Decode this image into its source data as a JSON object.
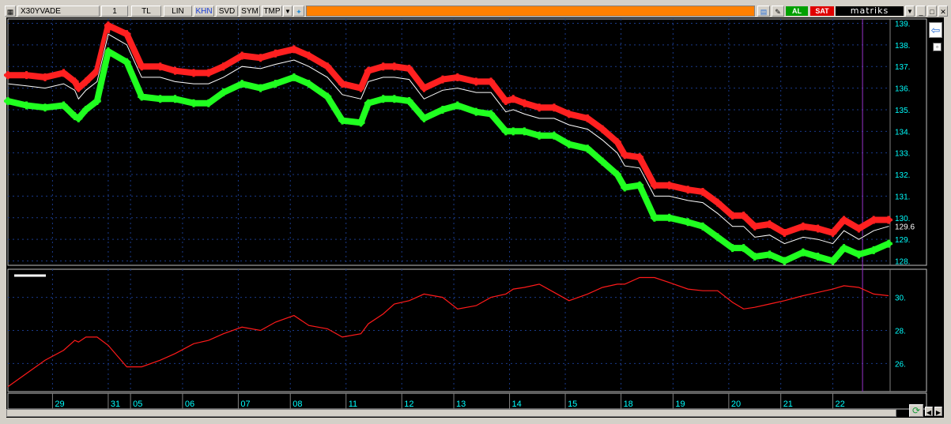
{
  "toolbar": {
    "symbol": "X30YVADE",
    "period": "1",
    "currency": "TL",
    "scale": "LIN",
    "khn": "KHN",
    "svd": "SVD",
    "sym": "SYM",
    "tmp": "TMP",
    "buy_label": "AL",
    "sell_label": "SAT",
    "brand": "matriks"
  },
  "colors": {
    "upper_band": "#ff2020",
    "lower_band": "#20ff20",
    "price": "#ffffff",
    "indicator": "#ff1a1a",
    "axis_text": "#00ffff",
    "grid": "#1a3a8a",
    "orange_bar": "#ff8000"
  },
  "chart_data": [
    {
      "type": "line",
      "panel": "price",
      "ylim": [
        127.8,
        139.2
      ],
      "yticks": [
        "128.",
        "129.",
        "130.",
        "131.",
        "132.",
        "133.",
        "134.",
        "135.",
        "136.",
        "137.",
        "138.",
        "139."
      ],
      "last_value_label": "129.6",
      "x_index": [
        0,
        5,
        10,
        15,
        18,
        19,
        21,
        24,
        27,
        32,
        36,
        41,
        45,
        50,
        54,
        58,
        63,
        68,
        72,
        77,
        81,
        86,
        90,
        95,
        97,
        101,
        104,
        108,
        112,
        117,
        121,
        126,
        130,
        134,
        136,
        139,
        143,
        147,
        151,
        156,
        160,
        164,
        166,
        170,
        174,
        178,
        183,
        187,
        191,
        195,
        198,
        201,
        205,
        209,
        214,
        218,
        222,
        225,
        229,
        233,
        237
      ],
      "series": [
        {
          "role": "upper",
          "values": [
            136.6,
            136.6,
            136.5,
            136.7,
            136.3,
            136.0,
            136.3,
            136.8,
            138.9,
            138.5,
            137.0,
            137.0,
            136.8,
            136.7,
            136.7,
            137.0,
            137.5,
            137.4,
            137.6,
            137.8,
            137.5,
            137.0,
            136.2,
            136.0,
            136.8,
            137.0,
            137.0,
            136.9,
            136.0,
            136.4,
            136.5,
            136.3,
            136.3,
            135.4,
            135.5,
            135.3,
            135.1,
            135.1,
            134.8,
            134.6,
            134.1,
            133.5,
            132.9,
            132.8,
            131.5,
            131.5,
            131.3,
            131.2,
            130.7,
            130.1,
            130.1,
            129.6,
            129.7,
            129.3,
            129.6,
            129.5,
            129.3,
            129.9,
            129.5,
            129.9,
            129.9
          ]
        },
        {
          "role": "price",
          "values": [
            136.2,
            136.1,
            136.0,
            136.2,
            135.9,
            135.5,
            135.9,
            136.3,
            138.5,
            138.0,
            136.5,
            136.5,
            136.3,
            136.2,
            136.2,
            136.5,
            137.0,
            136.9,
            137.1,
            137.3,
            137.0,
            136.5,
            135.7,
            135.5,
            136.3,
            136.5,
            136.5,
            136.4,
            135.5,
            135.9,
            136.0,
            135.8,
            135.8,
            134.9,
            135.0,
            134.8,
            134.6,
            134.6,
            134.3,
            134.1,
            133.6,
            133.0,
            132.4,
            132.3,
            131.0,
            131.0,
            130.8,
            130.7,
            130.2,
            129.6,
            129.6,
            129.1,
            129.2,
            128.8,
            129.1,
            129.0,
            128.8,
            129.4,
            129.0,
            129.4,
            129.6
          ]
        },
        {
          "role": "lower",
          "values": [
            135.4,
            135.2,
            135.1,
            135.2,
            134.7,
            134.6,
            135.0,
            135.4,
            137.7,
            137.2,
            135.6,
            135.5,
            135.5,
            135.3,
            135.3,
            135.8,
            136.2,
            136.0,
            136.2,
            136.5,
            136.2,
            135.6,
            134.5,
            134.4,
            135.3,
            135.5,
            135.5,
            135.4,
            134.6,
            135.0,
            135.2,
            134.9,
            134.8,
            134.0,
            134.0,
            134.0,
            133.8,
            133.8,
            133.4,
            133.2,
            132.6,
            132.0,
            131.4,
            131.5,
            130.0,
            130.0,
            129.8,
            129.6,
            129.1,
            128.6,
            128.6,
            128.2,
            128.3,
            128.0,
            128.4,
            128.2,
            128.0,
            128.6,
            128.3,
            128.5,
            128.8
          ]
        }
      ]
    },
    {
      "type": "line",
      "panel": "indicator",
      "ylim": [
        24.3,
        31.7
      ],
      "yticks": [
        "26.",
        "28.",
        "30."
      ],
      "x_index": [
        0,
        5,
        10,
        15,
        18,
        19,
        21,
        24,
        27,
        32,
        36,
        41,
        45,
        50,
        54,
        58,
        63,
        68,
        72,
        77,
        81,
        86,
        90,
        95,
        97,
        101,
        104,
        108,
        112,
        117,
        121,
        126,
        130,
        134,
        136,
        139,
        143,
        147,
        151,
        156,
        160,
        164,
        166,
        170,
        174,
        178,
        183,
        187,
        191,
        195,
        198,
        201,
        205,
        209,
        214,
        218,
        222,
        225,
        229,
        233,
        237
      ],
      "series": [
        {
          "role": "indicator",
          "values": [
            24.6,
            25.4,
            26.2,
            26.8,
            27.4,
            27.3,
            27.6,
            27.6,
            27.1,
            25.8,
            25.8,
            26.2,
            26.6,
            27.2,
            27.4,
            27.8,
            28.2,
            28.0,
            28.5,
            28.9,
            28.3,
            28.1,
            27.6,
            27.8,
            28.4,
            29.0,
            29.6,
            29.8,
            30.2,
            30.0,
            29.3,
            29.5,
            30.0,
            30.2,
            30.5,
            30.6,
            30.8,
            30.3,
            29.8,
            30.2,
            30.6,
            30.8,
            30.8,
            31.2,
            31.2,
            30.9,
            30.5,
            30.4,
            30.4,
            29.7,
            29.3,
            29.4,
            29.6,
            29.8,
            30.1,
            30.3,
            30.5,
            30.7,
            30.6,
            30.2,
            30.1
          ]
        }
      ]
    }
  ],
  "x_axis": {
    "ticks": [
      {
        "i": 12,
        "label": "29"
      },
      {
        "i": 27,
        "label": "31"
      },
      {
        "i": 33,
        "label": "05"
      },
      {
        "i": 47,
        "label": "06"
      },
      {
        "i": 62,
        "label": "07"
      },
      {
        "i": 76,
        "label": "08"
      },
      {
        "i": 91,
        "label": "11"
      },
      {
        "i": 106,
        "label": "12"
      },
      {
        "i": 120,
        "label": "13"
      },
      {
        "i": 135,
        "label": "14"
      },
      {
        "i": 150,
        "label": "15"
      },
      {
        "i": 165,
        "label": "18"
      },
      {
        "i": 179,
        "label": "19"
      },
      {
        "i": 194,
        "label": "20"
      },
      {
        "i": 208,
        "label": "21"
      },
      {
        "i": 222,
        "label": "22"
      }
    ],
    "x_max": 237
  }
}
